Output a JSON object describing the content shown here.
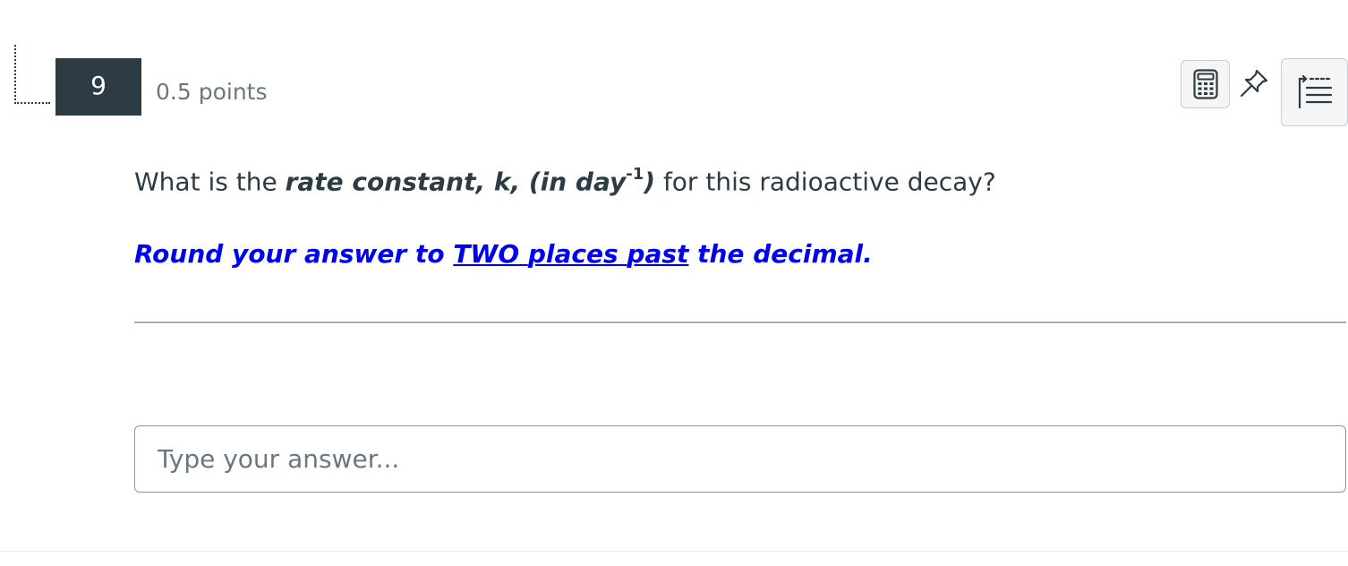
{
  "question": {
    "number": "9",
    "points": "0.5 points",
    "text_before": "What is the ",
    "text_bold": "rate constant, k, (in day",
    "text_sup": "-1",
    "text_bold_close": ")",
    "text_after": " for this radioactive decay?",
    "instruction_before": "Round your answer to ",
    "instruction_u1": "TWO",
    "instruction_u2": "places",
    "instruction_u3": "past",
    "instruction_after": " the decimal.",
    "answer_placeholder": "Type your answer...",
    "answer_value": ""
  },
  "toolbar": {
    "calculator_icon": "calculator-icon",
    "pin_icon": "pin-icon",
    "outline_icon": "outline-list-icon"
  },
  "colors": {
    "number_bg": "#2d3b45",
    "instruction": "#0000ee",
    "text": "#2d3b45"
  }
}
